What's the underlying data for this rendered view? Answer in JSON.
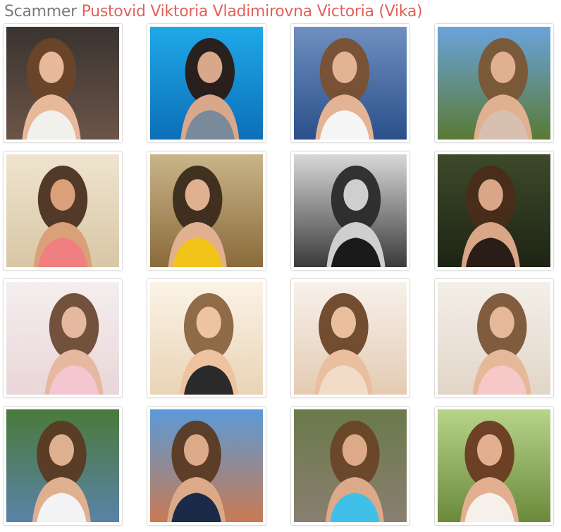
{
  "header": {
    "prefix": "Scammer",
    "name": "Pustovid Viktoria Vladimirovna Victoria (Vika)"
  },
  "colors": {
    "prefix_text": "#7a7a7a",
    "name_text": "#e0625a",
    "tile_border": "#dcdcdc"
  },
  "photos": [
    {
      "scene": "selfie-car-seat",
      "bg": [
        "#3a3330",
        "#6b5548"
      ],
      "hair": "#6b4528",
      "skin": "#e8b89a",
      "outfit": "#f2f0ec"
    },
    {
      "scene": "pool-dolphin",
      "bg": [
        "#1fa8e8",
        "#0c6fb8"
      ],
      "hair": "#2a1a14",
      "skin": "#d9a88a",
      "outfit": "#7a8a9a"
    },
    {
      "scene": "boat-sea",
      "bg": [
        "#6f8fc0",
        "#2b4f8a"
      ],
      "hair": "#7a5030",
      "skin": "#e3b394",
      "outfit": "#f5f5f5"
    },
    {
      "scene": "hilltop-sky",
      "bg": [
        "#6aa3dc",
        "#5a7a34"
      ],
      "hair": "#7a5634",
      "skin": "#e0b090",
      "outfit": "#d8c0b0"
    },
    {
      "scene": "beach-sand",
      "bg": [
        "#efe4cf",
        "#d8c7a5"
      ],
      "hair": "#4a3020",
      "skin": "#d9a07a",
      "outfit": "#f08080"
    },
    {
      "scene": "sun-statue",
      "bg": [
        "#c9b58a",
        "#8a6a3a"
      ],
      "hair": "#3a2a1c",
      "skin": "#e0b090",
      "outfit": "#f2c318"
    },
    {
      "scene": "bw-grass",
      "bg": [
        "#d8d8d8",
        "#3a3a3a"
      ],
      "hair": "#2a2a2a",
      "skin": "#cfcfcf",
      "outfit": "#1a1a1a"
    },
    {
      "scene": "dark-portrait",
      "bg": [
        "#3d4a2a",
        "#1e2414"
      ],
      "hair": "#4a2c1a",
      "skin": "#d9a688",
      "outfit": "#2a1c16"
    },
    {
      "scene": "winter-hood",
      "bg": [
        "#f5eeee",
        "#e9d6d9"
      ],
      "hair": "#6a4a34",
      "skin": "#e5b8a0",
      "outfit": "#f3c6d0"
    },
    {
      "scene": "sunny-selfie",
      "bg": [
        "#fbf3e6",
        "#e9d4b6"
      ],
      "hair": "#8a6440",
      "skin": "#edc3a0",
      "outfit": "#2a2a2a"
    },
    {
      "scene": "curly-selfie",
      "bg": [
        "#f7f1ea",
        "#e4cbb2"
      ],
      "hair": "#6a4428",
      "skin": "#eabf9e",
      "outfit": "#f2dcc8"
    },
    {
      "scene": "white-room",
      "bg": [
        "#f4efe9",
        "#e2d5c8"
      ],
      "hair": "#7a5436",
      "skin": "#e4b898",
      "outfit": "#f7c8c8"
    },
    {
      "scene": "park-fountain",
      "bg": [
        "#4a7a3a",
        "#5a82a8"
      ],
      "hair": "#5a3a22",
      "skin": "#dfb090",
      "outfit": "#f3f3f3"
    },
    {
      "scene": "promenade-bike",
      "bg": [
        "#5a9ad8",
        "#c87a52"
      ],
      "hair": "#5a3a22",
      "skin": "#dcaa88",
      "outfit": "#1c2a4a"
    },
    {
      "scene": "path-bike",
      "bg": [
        "#6a7a4a",
        "#8a7e70"
      ],
      "hair": "#6a4428",
      "skin": "#dcaa88",
      "outfit": "#40c0e8"
    },
    {
      "scene": "dog-garden",
      "bg": [
        "#b7d48a",
        "#6a8a3a"
      ],
      "hair": "#6a3a22",
      "skin": "#e2b090",
      "outfit": "#f6f0ea"
    }
  ]
}
